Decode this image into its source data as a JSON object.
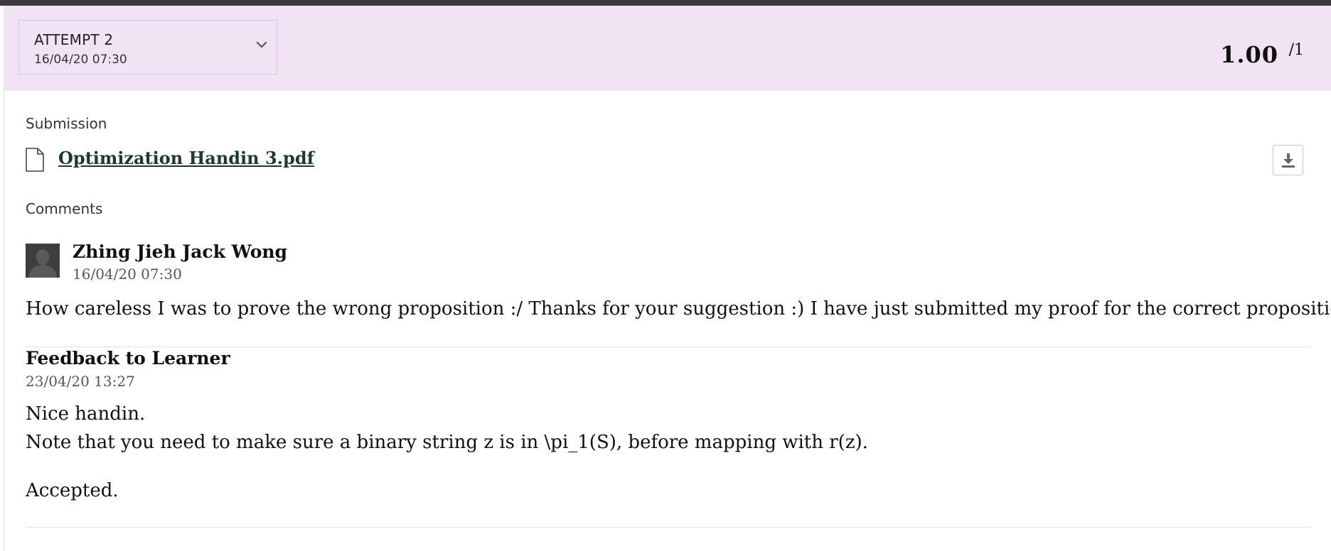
{
  "attempt": {
    "label": "ATTEMPT 2",
    "date": "16/04/20 07:30",
    "grade_score": "1.00",
    "grade_max": "/1"
  },
  "submission": {
    "section_label": "Submission",
    "file_name": "Optimization Handin 3.pdf"
  },
  "comments": {
    "section_label": "Comments",
    "author": "Zhing Jieh Jack Wong",
    "date": "16/04/20 07:30",
    "text": "How careless I was to prove the wrong proposition  :/ Thanks for your suggestion :) I have just submitted my proof for the correct proposition."
  },
  "feedback": {
    "title": "Feedback to Learner",
    "date": "23/04/20 13:27",
    "lines": [
      "Nice handin.",
      "Note that you need to make sure a binary string z is in \\pi_1(S), before mapping with r(z).",
      "Accepted."
    ]
  },
  "colors": {
    "header_bg": "#f1e3f4",
    "top_bar": "#3d383d",
    "link": "#1d3a2e",
    "selector_border": "#b9d2ea"
  },
  "icons": [
    "chevron-down-icon",
    "file-icon",
    "download-icon",
    "avatar-silhouette-icon"
  ]
}
